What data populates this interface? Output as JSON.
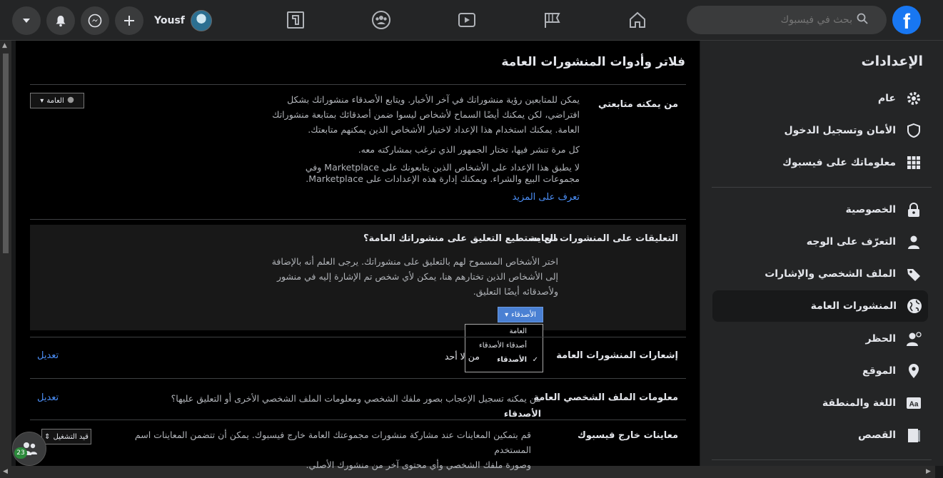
{
  "topbar": {
    "user_name": "Yousf",
    "search_placeholder": "بحث في فيسبوك",
    "logo_letter": "f",
    "nav_icons": [
      "home-icon",
      "pages-flag-icon",
      "watch-video-icon",
      "groups-icon",
      "gaming-icon"
    ],
    "action_icons": [
      "plus-icon",
      "messenger-icon",
      "notifications-bell-icon",
      "account-menu-chevron-icon"
    ]
  },
  "sidebar": {
    "title": "الإعدادات",
    "items": [
      {
        "label": "عام",
        "icon": "gear-icon"
      },
      {
        "label": "الأمان وتسجيل الدخول",
        "icon": "shield-icon"
      },
      {
        "label": "معلوماتك على فيسبوك",
        "icon": "grid-icon"
      },
      {
        "label": "الخصوصية",
        "icon": "lock-icon"
      },
      {
        "label": "التعرّف على الوجه",
        "icon": "face-recognition-icon"
      },
      {
        "label": "الملف الشخصي والإشارات",
        "icon": "tag-icon"
      },
      {
        "label": "المنشورات العامة",
        "icon": "globe-icon",
        "active": true
      },
      {
        "label": "الحظر",
        "icon": "block-user-icon"
      },
      {
        "label": "الموقع",
        "icon": "location-pin-icon"
      },
      {
        "label": "اللغة والمنطقة",
        "icon": "language-icon"
      },
      {
        "label": "القصص",
        "icon": "book-icon"
      }
    ]
  },
  "main": {
    "title": "فلاتر وأدوات المنشورات العامة",
    "followers": {
      "label": "من يمكنه متابعتي",
      "p1": [
        "يمكن للمتابعين رؤية منشوراتك في آخر الأخبار. ويتابع الأصدقاء منشوراتك بشكل",
        "افتراضي، لكن يمكنك أيضًا السماح لأشخاص ليسوا ضمن أصدقائك بمتابعة منشوراتك",
        "العامة. يمكنك استخدام هذا الإعداد لاختيار الأشخاص الذين يمكنهم متابعتك."
      ],
      "p2": "كل مرة تنشر فيها، تختار الجمهور الذي ترغب بمشاركته معه.",
      "p3": [
        "لا يطبق هذا الإعداد على الأشخاص الذين يتابعونك على Marketplace وفي",
        "مجموعات البيع والشراء. ويمكنك إدارة هذه الإعدادات على Marketplace."
      ],
      "learn_more": "تعرف على المزيد",
      "audience": "العامة"
    },
    "comments": {
      "label": "التعليقات على المنشورات العامة",
      "question": "من يستطيع التعليق على منشوراتك العامة؟",
      "desc": [
        "اختر الأشخاص المسموح لهم بالتعليق على منشوراتك. يرجى العلم أنه بالإضافة",
        "إلى الأشخاص الذين تختارهم هنا، يمكن لأي شخص تم الإشارة إليه في منشور",
        "ولأصدقائه أيضًا التعليق."
      ],
      "selected": "الأصدقاء",
      "options": [
        "العامة",
        "أصدقاء الأصدقاء",
        "الأصدقاء"
      ]
    },
    "notifications": {
      "label": "إشعارات المنشورات العامة",
      "value": "من لا أحد",
      "edit": "تعديل"
    },
    "profile_info": {
      "label": "معلومات الملف الشخصي العامة",
      "value": "من يمكنه تسجيل الإعجاب بصور ملفك الشخصي ومعلومات الملف الشخصي الأخرى أو التعليق عليها؟",
      "value_bold": "الأصدقاء",
      "edit": "تعديل"
    },
    "off_facebook": {
      "label": "معاينات خارج فيسبوك",
      "desc": [
        "قم بتمكين المعاينات عند مشاركة منشورات مجموعتك العامة خارج فيسبوك. يمكن أن تتضمن المعاينات اسم المستخدم",
        "وصورة ملفك الشخصي وأي محتوى آخر من منشورك الأصلي."
      ],
      "status": "قيد التشغيل"
    }
  },
  "chat": {
    "badge": "23"
  },
  "colors": {
    "accent": "#1877f2",
    "link": "#4b8ef5",
    "background": "#18191a"
  }
}
